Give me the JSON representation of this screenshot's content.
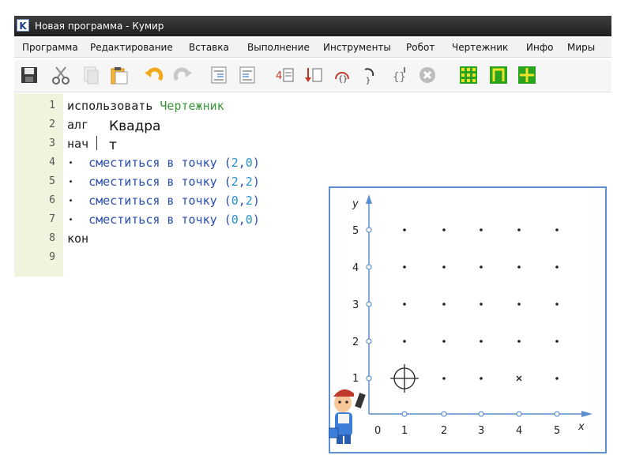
{
  "window": {
    "title": "Новая программа - Кумир",
    "app_icon": "K"
  },
  "menu": [
    "Программа",
    "Редактирование",
    "Вставка",
    "Выполнение",
    "Инструменты",
    "Робот",
    "Чертежник",
    "Инфо",
    "Миры"
  ],
  "toolbar": {
    "icons": [
      "save-icon",
      "cut-icon",
      "copy-icon",
      "paste-icon",
      "undo-icon",
      "redo-icon",
      "indent-icon",
      "unindent-icon",
      "step-icon",
      "step-into-icon",
      "step-over-icon",
      "step-out-icon",
      "run-to-icon",
      "stop-icon",
      "grid-icon",
      "pi-icon",
      "layout-icon"
    ]
  },
  "editor": {
    "line_numbers": [
      "1",
      "2",
      "3",
      "4",
      "5",
      "6",
      "7",
      "8",
      "9"
    ],
    "line1": {
      "kw": "использовать",
      "name": "Чертежник"
    },
    "line2": {
      "kw": "алг"
    },
    "line3": {
      "kw": "нач"
    },
    "move_cmd": "сместиться в точку",
    "moves": [
      {
        "x": "2",
        "y": "0"
      },
      {
        "x": "2",
        "y": "2"
      },
      {
        "x": "0",
        "y": "2"
      },
      {
        "x": "0",
        "y": "0"
      }
    ],
    "line8": {
      "kw": "кон"
    },
    "overlay_line1": "Квадра",
    "overlay_line2": "т"
  },
  "figure": {
    "y_axis_label": "y",
    "x_axis_label": "x",
    "origin_label": "0",
    "x_ticks": [
      "1",
      "2",
      "3",
      "4",
      "5"
    ],
    "y_ticks": [
      "1",
      "2",
      "3",
      "4",
      "5"
    ],
    "border_color": "#5b8fd0",
    "axis_color": "#5b8fd0",
    "crosshair_at": {
      "x": 1,
      "y": 1
    },
    "cross_mark_at": {
      "x": 4,
      "y": 1
    },
    "mascot": "drawer-mascot"
  }
}
